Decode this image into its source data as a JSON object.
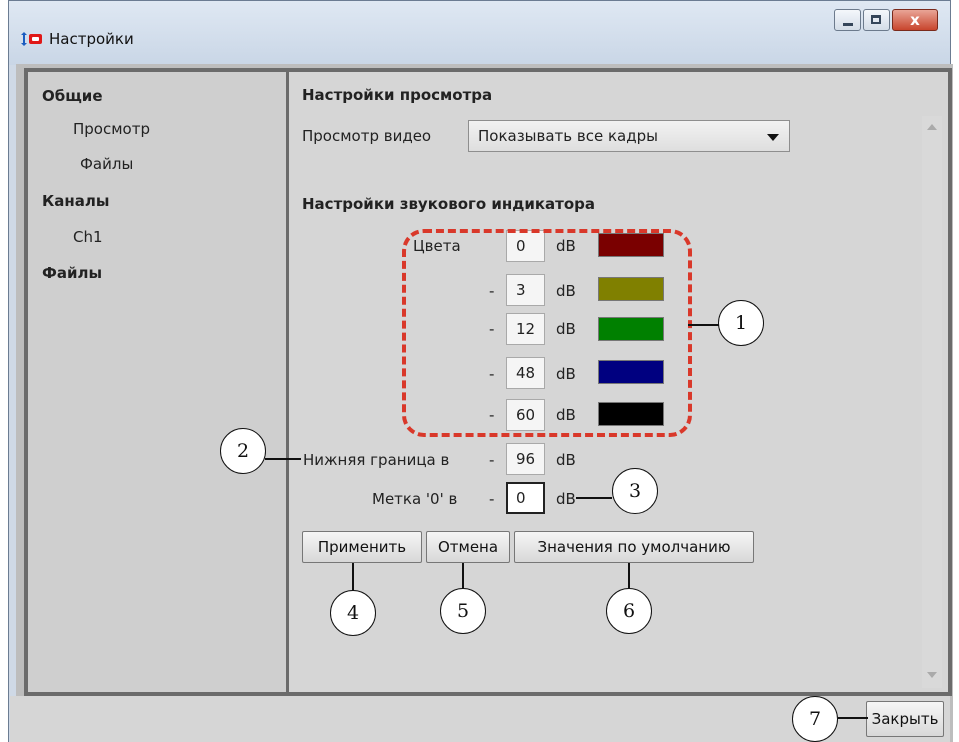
{
  "window": {
    "title": "Настройки"
  },
  "sidebar": {
    "items": [
      {
        "label": "Общие"
      },
      {
        "label": "Просмотр"
      },
      {
        "label": "Файлы"
      },
      {
        "label": "Каналы"
      },
      {
        "label": "Ch1"
      },
      {
        "label": "Файлы"
      }
    ]
  },
  "view_settings": {
    "title": "Настройки просмотра",
    "video_label": "Просмотр видео",
    "video_value": "Показывать все кадры"
  },
  "audio_settings": {
    "title": "Настройки звукового индикатора",
    "colors_label": "Цвета",
    "dash": "-",
    "unit": "dB",
    "levels": [
      {
        "value": "0",
        "color": "#7a0000"
      },
      {
        "value": "3",
        "color": "#808000"
      },
      {
        "value": "12",
        "color": "#008000"
      },
      {
        "value": "48",
        "color": "#000080"
      },
      {
        "value": "60",
        "color": "#000000"
      }
    ],
    "lower_bound_label": "Нижняя граница в",
    "lower_bound_value": "96",
    "zero_mark_label": "Метка '0' в",
    "zero_mark_value": "0"
  },
  "buttons": {
    "apply": "Применить",
    "cancel": "Отмена",
    "defaults": "Значения по умолчанию",
    "close": "Закрыть"
  },
  "callouts": [
    "1",
    "2",
    "3",
    "4",
    "5",
    "6",
    "7"
  ]
}
